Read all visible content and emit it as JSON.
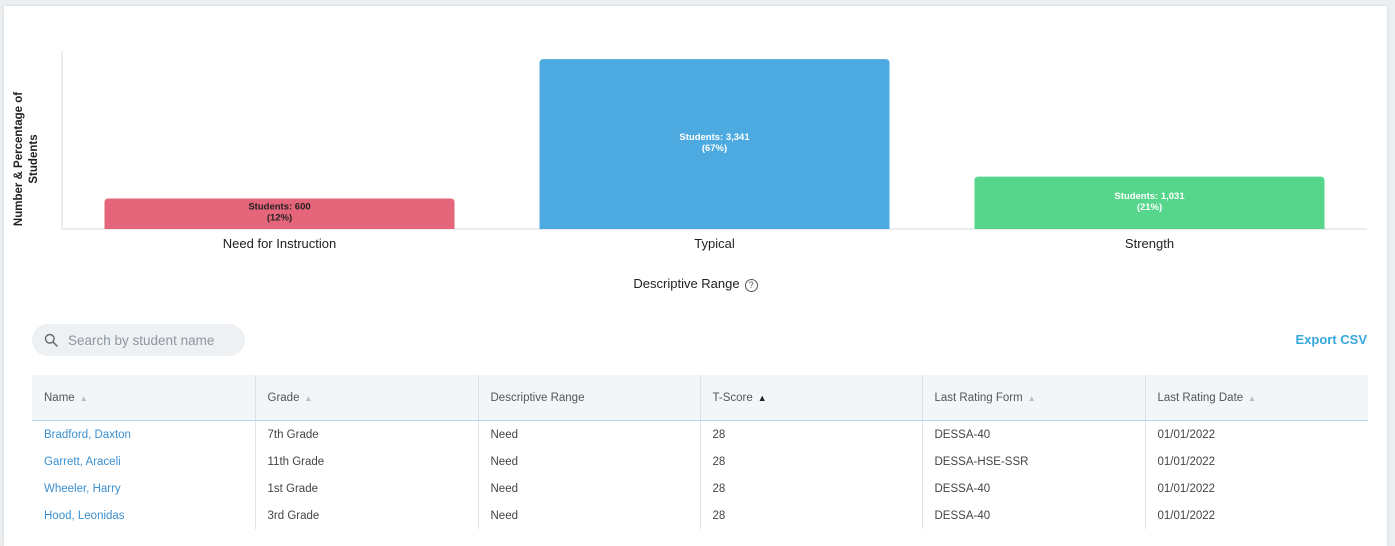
{
  "chart_data": {
    "type": "bar",
    "categories": [
      "Need for Instruction",
      "Typical",
      "Strength"
    ],
    "values": [
      600,
      3341,
      1031
    ],
    "percentages": [
      "12%",
      "67%",
      "21%"
    ],
    "bar_labels": [
      "Students: 600",
      "Students: 3,341",
      "Students: 1,031"
    ],
    "colors": [
      "#e5657a",
      "#4daae0",
      "#56d68a"
    ],
    "label_colors": [
      "#222222",
      "#ffffff",
      "#ffffff"
    ],
    "xlabel": "Descriptive Range",
    "ylabel": "Number & Percentage of Students",
    "ylim": [
      0,
      3500
    ],
    "grid": false
  },
  "search": {
    "placeholder": "Search by student name",
    "icon": "search-icon"
  },
  "export_label": "Export CSV",
  "table": {
    "columns": [
      "Name",
      "Grade",
      "Descriptive Range",
      "T-Score",
      "Last Rating Form",
      "Last Rating Date"
    ],
    "rows": [
      [
        "Bradford, Daxton",
        "7th Grade",
        "Need",
        "28",
        "DESSA-40",
        "01/01/2022"
      ],
      [
        "Garrett, Araceli",
        "11th Grade",
        "Need",
        "28",
        "DESSA-HSE-SSR",
        "01/01/2022"
      ],
      [
        "Wheeler, Harry",
        "1st Grade",
        "Need",
        "28",
        "DESSA-40",
        "01/01/2022"
      ],
      [
        "Hood, Leonidas",
        "3rd Grade",
        "Need",
        "28",
        "DESSA-40",
        "01/01/2022"
      ]
    ]
  }
}
